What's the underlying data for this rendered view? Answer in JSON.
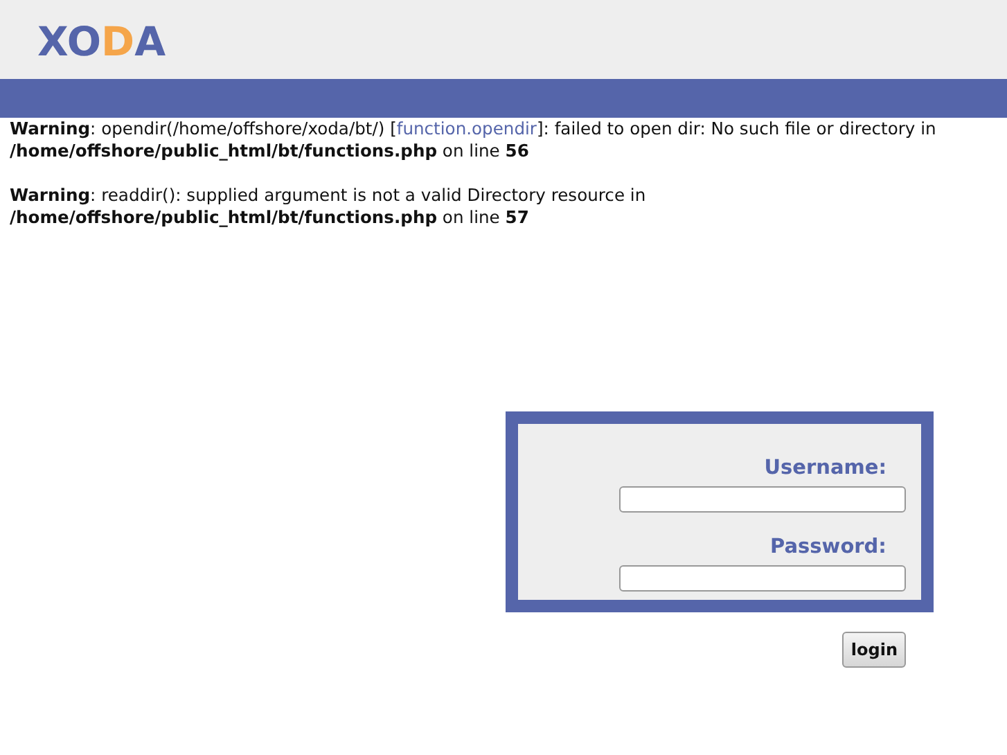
{
  "logo": [
    {
      "text": "XO",
      "color": "#5565aa"
    },
    {
      "text": "D",
      "color": "#f5a54a"
    },
    {
      "text": "A",
      "color": "#5565aa"
    }
  ],
  "warnings": [
    {
      "before": "**Warning**: opendir(/home/offshore/xoda/bt/) [",
      "link": "function.opendir",
      "after": "]: failed to open dir: No such file or directory in **/home/offshore/public_html/bt/functions.php** on line **56**"
    },
    {
      "before": "**Warning**: readdir(): supplied argument is not a valid Directory resource in **/home/offshore/public_html/bt/functions.php** on line **57**"
    }
  ],
  "login_form": {
    "fields": [
      {
        "label": "Username:"
      },
      {
        "label": "Password:"
      }
    ],
    "button": "login"
  }
}
